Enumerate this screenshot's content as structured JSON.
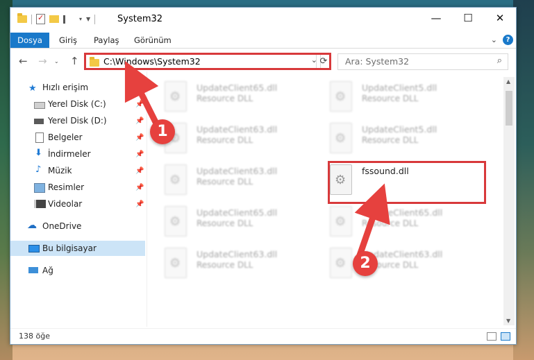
{
  "window": {
    "title": "System32",
    "controls": {
      "minimize": "—",
      "maximize": "☐",
      "close": "✕"
    }
  },
  "ribbon": {
    "tabs": [
      "Dosya",
      "Giriş",
      "Paylaş",
      "Görünüm"
    ]
  },
  "navigation": {
    "address": "C:\\Windows\\System32",
    "search_placeholder": "Ara: System32"
  },
  "sidebar": {
    "quick_access": "Hızlı erişim",
    "items": [
      {
        "label": "Yerel Disk (C:)",
        "icon": "drive-icon",
        "pinned": true
      },
      {
        "label": "Yerel Disk (D:)",
        "icon": "drive-icon",
        "pinned": true
      },
      {
        "label": "Belgeler",
        "icon": "documents-icon",
        "pinned": true
      },
      {
        "label": "İndirmeler",
        "icon": "download-icon",
        "pinned": true
      },
      {
        "label": "Müzik",
        "icon": "music-icon",
        "pinned": true
      },
      {
        "label": "Resimler",
        "icon": "pictures-icon",
        "pinned": true
      },
      {
        "label": "Videolar",
        "icon": "videos-icon",
        "pinned": true
      }
    ],
    "onedrive": "OneDrive",
    "this_pc": "Bu bilgisayar",
    "network": "Ağ"
  },
  "files": {
    "left": [
      {
        "name": "UpdateClient65.dll",
        "type": "Resource DLL"
      },
      {
        "name": "UpdateClient63.dll",
        "type": "Resource DLL"
      },
      {
        "name": "UpdateClient63.dll",
        "type": "Resource DLL"
      },
      {
        "name": "UpdateClient65.dll",
        "type": "Resource DLL"
      },
      {
        "name": "UpdateClient63.dll",
        "type": "Resource DLL"
      }
    ],
    "right": [
      {
        "name": "UpdateClient5.dll",
        "type": "Resource DLL"
      },
      {
        "name": "UpdateClient5.dll",
        "type": "Resource DLL"
      },
      {
        "name": "fssound.dll",
        "type": ""
      },
      {
        "name": "UpdateClient65.dll",
        "type": "Resource DLL"
      },
      {
        "name": "UpdateClient63.dll",
        "type": "Resource DLL"
      }
    ]
  },
  "status": {
    "item_count": "138 öğe"
  },
  "annotations": {
    "step1": "1",
    "step2": "2"
  },
  "colors": {
    "accent": "#1979ca",
    "highlight": "#d8393b",
    "badge": "#e6413e"
  }
}
